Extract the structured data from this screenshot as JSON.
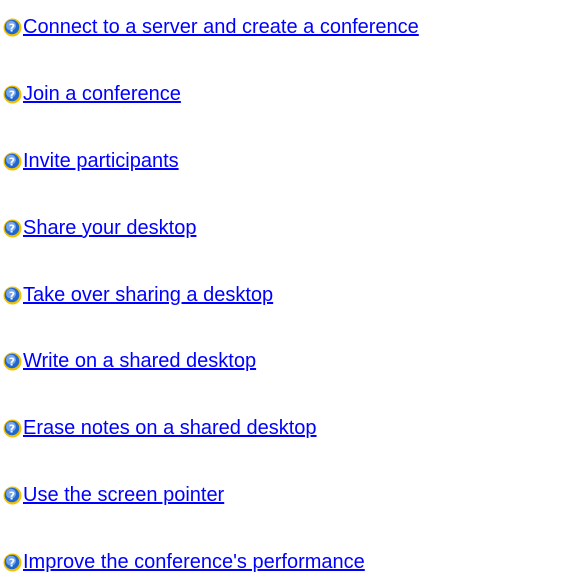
{
  "icon": "help-question-icon",
  "colors": {
    "link": "#0000ff",
    "icon_blue": "#1f66d1",
    "icon_light": "#b9d8ff",
    "icon_yellow": "#f2c200",
    "background": "#ffffff"
  },
  "topics": [
    {
      "label": "Connect to a server and create a conference"
    },
    {
      "label": "Join a conference"
    },
    {
      "label": "Invite participants"
    },
    {
      "label": "Share your desktop"
    },
    {
      "label": "Take over sharing a desktop"
    },
    {
      "label": "Write on a shared desktop"
    },
    {
      "label": "Erase notes on a shared desktop"
    },
    {
      "label": "Use the screen pointer"
    },
    {
      "label": "Improve the conference's performance"
    }
  ]
}
